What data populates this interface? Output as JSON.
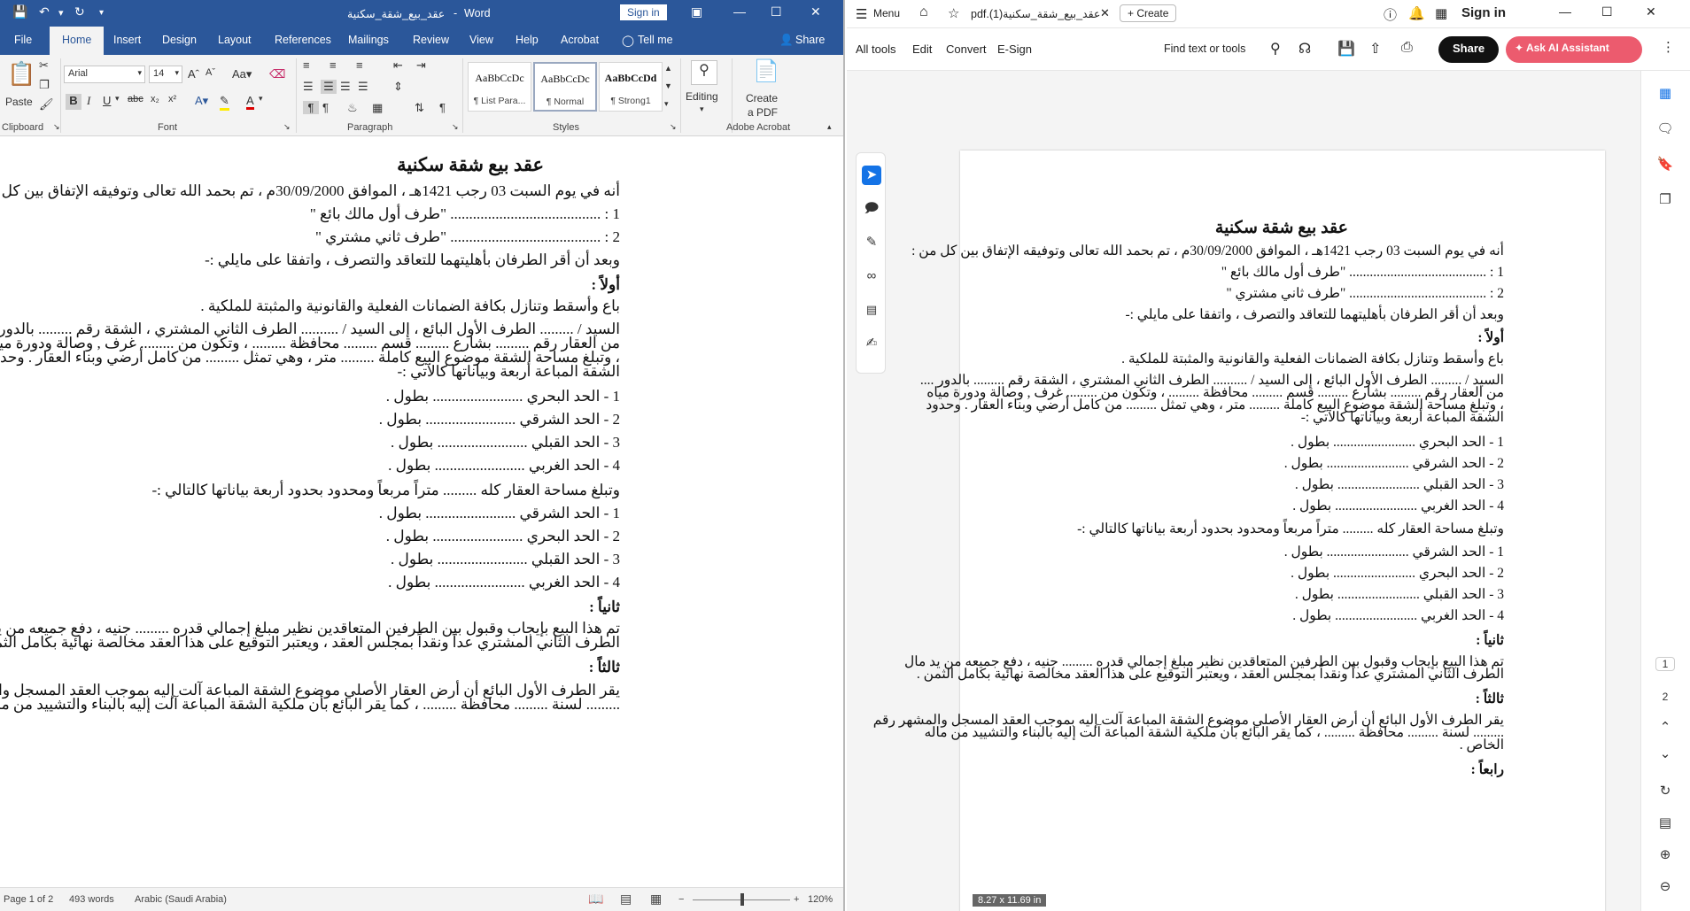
{
  "word": {
    "titlebar": {
      "doc_title": "عقد_بيع_شقة_سكنية",
      "app_name": "Word",
      "signin": "Sign in"
    },
    "tabs": [
      "File",
      "Home",
      "Insert",
      "Design",
      "Layout",
      "References",
      "Mailings",
      "Review",
      "View",
      "Help",
      "Acrobat"
    ],
    "tell_me": "Tell me",
    "share": "Share",
    "ribbon": {
      "paste": "Paste",
      "clipboard": "Clipboard",
      "font_name": "Arial",
      "font_size": "14",
      "font": "Font",
      "paragraph": "Paragraph",
      "styles_label": "Styles",
      "styles": [
        {
          "preview": "AaBbCcDc",
          "name": "¶ List Para..."
        },
        {
          "preview": "AaBbCcDc",
          "name": "¶ Normal"
        },
        {
          "preview": "AaBbCcDd",
          "name": "¶ Strong1"
        }
      ],
      "editing": "Editing",
      "create_pdf_1": "Create",
      "create_pdf_2": "a PDF",
      "adobe_acrobat": "Adobe Acrobat"
    },
    "doc_lines": [
      {
        "text": "عقد بيع شقة سكنية",
        "style": "title"
      },
      {
        "text": "أنه في يوم السبت 03 رجب 1421هـ ، الموافق 30/09/2000م ، تم بحمد الله تعالى وتوفيقه الإتفاق بين كل من :",
        "style": ""
      },
      {
        "text": "1 : ........................................ \"طرف أول مالك بائع \"",
        "style": ""
      },
      {
        "text": "2 : ........................................ \"طرف ثاني مشتري \"",
        "style": ""
      },
      {
        "text": "وبعد أن أقر الطرفان بأهليتهما للتعاقد والتصرف ، واتفقا على مايلي :-",
        "style": ""
      },
      {
        "text": "أولاً :",
        "style": "bold"
      },
      {
        "text": "باع وأسقط وتنازل بكافة الضمانات الفعلية والقانونية والمثبتة للملكية .",
        "style": ""
      },
      {
        "text": "السيد / ......... الطرف الأول البائع ، إلى السيد / .......... الطرف الثاني المشتري ، الشقة رقم ......... بالدور ....",
        "style": ""
      },
      {
        "text": "من العقار رقم ......... بشارع ......... قسم ......... محافظة ......... ، وتكون من ......... غرف , وصالة ودورة مياه",
        "style": ""
      },
      {
        "text": "، وتبلغ مساحة الشقة موضوع البيع كاملة ......... متر ، وهي تمثل ......... من كامل أرضي وبناء العقار . وحدود",
        "style": ""
      },
      {
        "text": "الشقة المباعة أربعة وبياناتها كالآتي :-",
        "style": ""
      },
      {
        "text": "1 - الحد البحري ........................ بطول .",
        "style": ""
      },
      {
        "text": "2 - الحد الشرقي ........................ بطول .",
        "style": ""
      },
      {
        "text": "3 - الحد القبلي ........................ بطول .",
        "style": ""
      },
      {
        "text": "4 - الحد الغربي ........................ بطول .",
        "style": ""
      },
      {
        "text": "وتبلغ مساحة العقار كله ......... متراً مربعاً ومحدود بحدود أربعة بياناتها كالتالي :-",
        "style": ""
      },
      {
        "text": "1 - الحد الشرقي ........................ بطول .",
        "style": ""
      },
      {
        "text": "2 - الحد البحري ........................ بطول .",
        "style": ""
      },
      {
        "text": "3 - الحد القبلي ........................ بطول .",
        "style": ""
      },
      {
        "text": "4 - الحد الغربي ........................ بطول .",
        "style": ""
      },
      {
        "text": "ثانياً :",
        "style": "bold"
      },
      {
        "text": "تم هذا البيع بإيجاب وقبول بين الطرفين المتعاقدين نظير مبلغ إجمالي قدره ......... جنيه ، دفع جميعه من يد مال",
        "style": ""
      },
      {
        "text": "الطرف الثاني المشتري عداً ونقداً بمجلس العقد ، ويعتبر التوقيع على هذا العقد مخالصة نهائية بكامل الثمن .",
        "style": ""
      },
      {
        "text": "ثالثاً :",
        "style": "bold"
      },
      {
        "text": "يقر الطرف الأول البائع أن أرض العقار الأصلي موضوع الشقة المباعة آلت إليه بموجب العقد المسجل والمشهر رقم",
        "style": ""
      },
      {
        "text": "......... لسنة ......... محافظة ......... ، كما يقر البائع بأن ملكية الشقة المباعة آلت إليه بالبناء والتشييد من ماله",
        "style": ""
      }
    ],
    "status": {
      "page": "Page 1 of 2",
      "words": "493 words",
      "language": "Arabic (Saudi Arabia)",
      "zoom": "120%"
    }
  },
  "acrobat": {
    "menu": "Menu",
    "tab_title": "pdf.(1)عقد_بيع_شقة_سكنية",
    "create": "Create",
    "signin": "Sign in",
    "toolbar": {
      "all_tools": "All tools",
      "edit": "Edit",
      "convert": "Convert",
      "esign": "E-Sign",
      "find": "Find text or tools",
      "share": "Share",
      "ask_ai": "Ask AI Assistant"
    },
    "page_numbers": [
      "1",
      "2"
    ],
    "page_size": "8.27 x 11.69 in",
    "pdf_lines": [
      {
        "text": "عقد بيع شقة سكنية",
        "style": "title"
      },
      {
        "text": "أنه في يوم السبت 03 رجب 1421هـ ، الموافق 30/09/2000م ، تم بحمد الله تعالى وتوفيقه الإتفاق بين كل من :",
        "style": ""
      },
      {
        "text": "1 : ........................................ \"طرف أول مالك بائع \"",
        "style": ""
      },
      {
        "text": "2 : ........................................ \"طرف ثاني مشتري \"",
        "style": ""
      },
      {
        "text": "وبعد أن أقر الطرفان بأهليتهما للتعاقد والتصرف ، واتفقا على مايلي :-",
        "style": ""
      },
      {
        "text": "أولاً :",
        "style": "bold"
      },
      {
        "text": "باع وأسقط وتنازل بكافة الضمانات الفعلية والقانونية والمثبتة للملكية .",
        "style": ""
      },
      {
        "text": "السيد / ......... الطرف الأول البائع ، إلى السيد / .......... الطرف الثاني المشتري ، الشقة رقم ......... بالدور ....",
        "style": ""
      },
      {
        "text": "من العقار رقم ......... بشارع ......... قسم ......... محافظة ......... ، وتكون من ......... غرف , وصالة ودورة مياه",
        "style": ""
      },
      {
        "text": "، وتبلغ مساحة الشقة موضوع البيع كاملة ......... متر ، وهي تمثل ......... من كامل أرضي وبناء العقار . وحدود",
        "style": ""
      },
      {
        "text": "الشقة المباعة أربعة وبياناتها كالآتي :-",
        "style": ""
      },
      {
        "text": "1 - الحد البحري ........................ بطول .",
        "style": ""
      },
      {
        "text": "2 - الحد الشرقي ........................ بطول .",
        "style": ""
      },
      {
        "text": "3 - الحد القبلي ........................ بطول .",
        "style": ""
      },
      {
        "text": "4 - الحد الغربي ........................ بطول .",
        "style": ""
      },
      {
        "text": "وتبلغ مساحة العقار كله ......... متراً مربعاً ومحدود بحدود أربعة بياناتها كالتالي :-",
        "style": ""
      },
      {
        "text": "1 - الحد الشرقي ........................ بطول .",
        "style": ""
      },
      {
        "text": "2 - الحد البحري ........................ بطول .",
        "style": ""
      },
      {
        "text": "3 - الحد القبلي ........................ بطول .",
        "style": ""
      },
      {
        "text": "4 - الحد الغربي ........................ بطول .",
        "style": ""
      },
      {
        "text": "ثانياً :",
        "style": "bold"
      },
      {
        "text": "تم هذا البيع بإيجاب وقبول بين الطرفين المتعاقدين نظير مبلغ إجمالي قدره ......... جنيه ، دفع جميعه من يد مال",
        "style": ""
      },
      {
        "text": "الطرف الثاني المشتري عداً ونقداً بمجلس العقد ، ويعتبر التوقيع على هذا العقد مخالصة نهائية بكامل الثمن .",
        "style": ""
      },
      {
        "text": "ثالثاً :",
        "style": "bold"
      },
      {
        "text": "يقر الطرف الأول البائع أن أرض العقار الأصلي موضوع الشقة المباعة آلت إليه بموجب العقد المسجل والمشهر رقم",
        "style": ""
      },
      {
        "text": "......... لسنة ......... محافظة ......... ، كما يقر البائع بأن ملكية الشقة المباعة آلت إليه بالبناء والتشييد من ماله",
        "style": ""
      },
      {
        "text": "الخاص .",
        "style": ""
      },
      {
        "text": "رابعاً :",
        "style": "bold"
      }
    ]
  },
  "colors": {
    "word_blue": "#2b579a",
    "acrobat_red": "#e8412f",
    "ai_pink": "#ec5b6e"
  }
}
